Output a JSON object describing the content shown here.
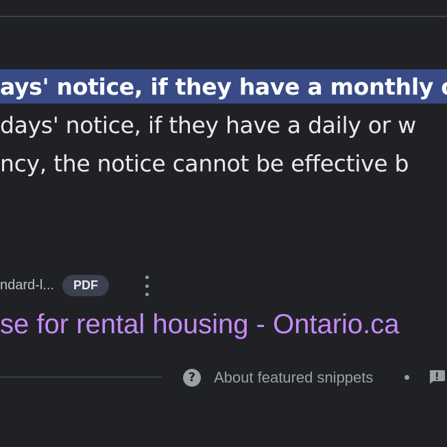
{
  "snippet": {
    "lines": [
      "ays' notice, if they have a monthly o",
      "days' notice, if they have a daily or w",
      "ncy, the notice cannot be effective b"
    ]
  },
  "source": {
    "url_text": "ndard-l...",
    "badge": "PDF",
    "more_icon": "more-vert-icon"
  },
  "result": {
    "title": "se for rental housing - Ontario.ca"
  },
  "footer": {
    "help_icon_glyph": "?",
    "about_label": "About featured snippets",
    "feedback_icon": "feedback-icon"
  },
  "colors": {
    "background": "#202124",
    "highlight": "#394b86",
    "link": "#c58af9",
    "muted": "#9aa0a6"
  }
}
